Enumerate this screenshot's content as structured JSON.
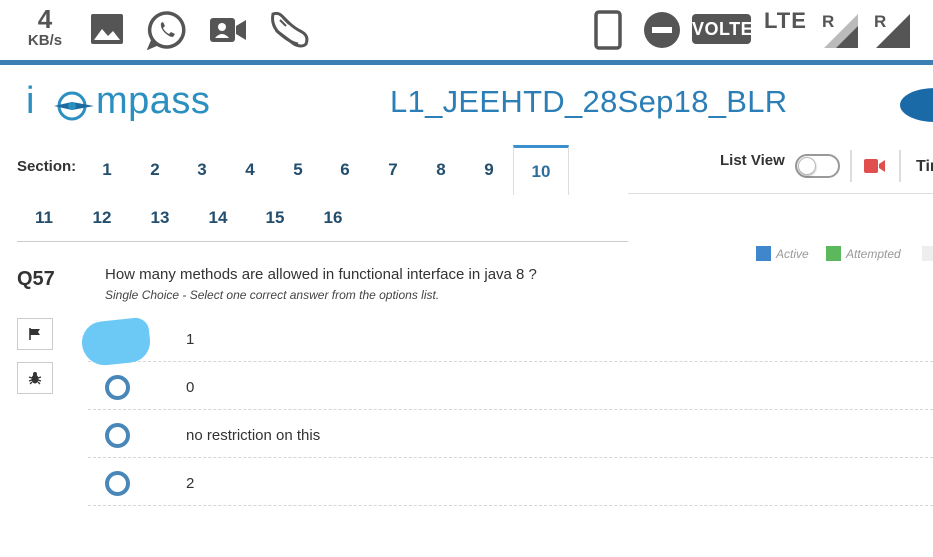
{
  "status_bar": {
    "speed_value": "4",
    "speed_unit": "KB/s",
    "icons": [
      "gallery-icon",
      "whatsapp-icon",
      "video-call-icon",
      "sneaker-icon",
      "phone-portrait-icon",
      "do-not-disturb-icon"
    ],
    "volte": "VOLTE",
    "lte": "LTE",
    "roaming_1": "R",
    "roaming_2": "R"
  },
  "header": {
    "logo_text": "i compass",
    "logo_tail": "mpass",
    "logo_head": "ic",
    "test_title": "L1_JEEHTD_28Sep18_BLR"
  },
  "sections": {
    "label": "Section:",
    "items": [
      "1",
      "2",
      "3",
      "4",
      "5",
      "6",
      "7",
      "8",
      "9",
      "10",
      "11",
      "12",
      "13",
      "14",
      "15",
      "16"
    ],
    "active": "10"
  },
  "toolbar": {
    "list_view_label": "List View",
    "list_view_on": false,
    "timer_label": "Tir"
  },
  "legend": {
    "items": [
      {
        "label": "Active",
        "color": "#3f86cc"
      },
      {
        "label": "Attempted",
        "color": "#5cb85c"
      }
    ]
  },
  "question": {
    "number": "Q57",
    "text": "How many methods are allowed in functional interface in java 8 ?",
    "type_hint": "Single Choice - Select one correct answer from the options list.",
    "options": [
      "1",
      "0",
      "no restriction on this",
      "2"
    ],
    "selected_index": 0
  },
  "colors": {
    "accent": "#3c7fb4",
    "title": "#2b7fb6",
    "section_number": "#234e6d",
    "radio": "#4a87b9",
    "camera": "#e04e4e"
  }
}
